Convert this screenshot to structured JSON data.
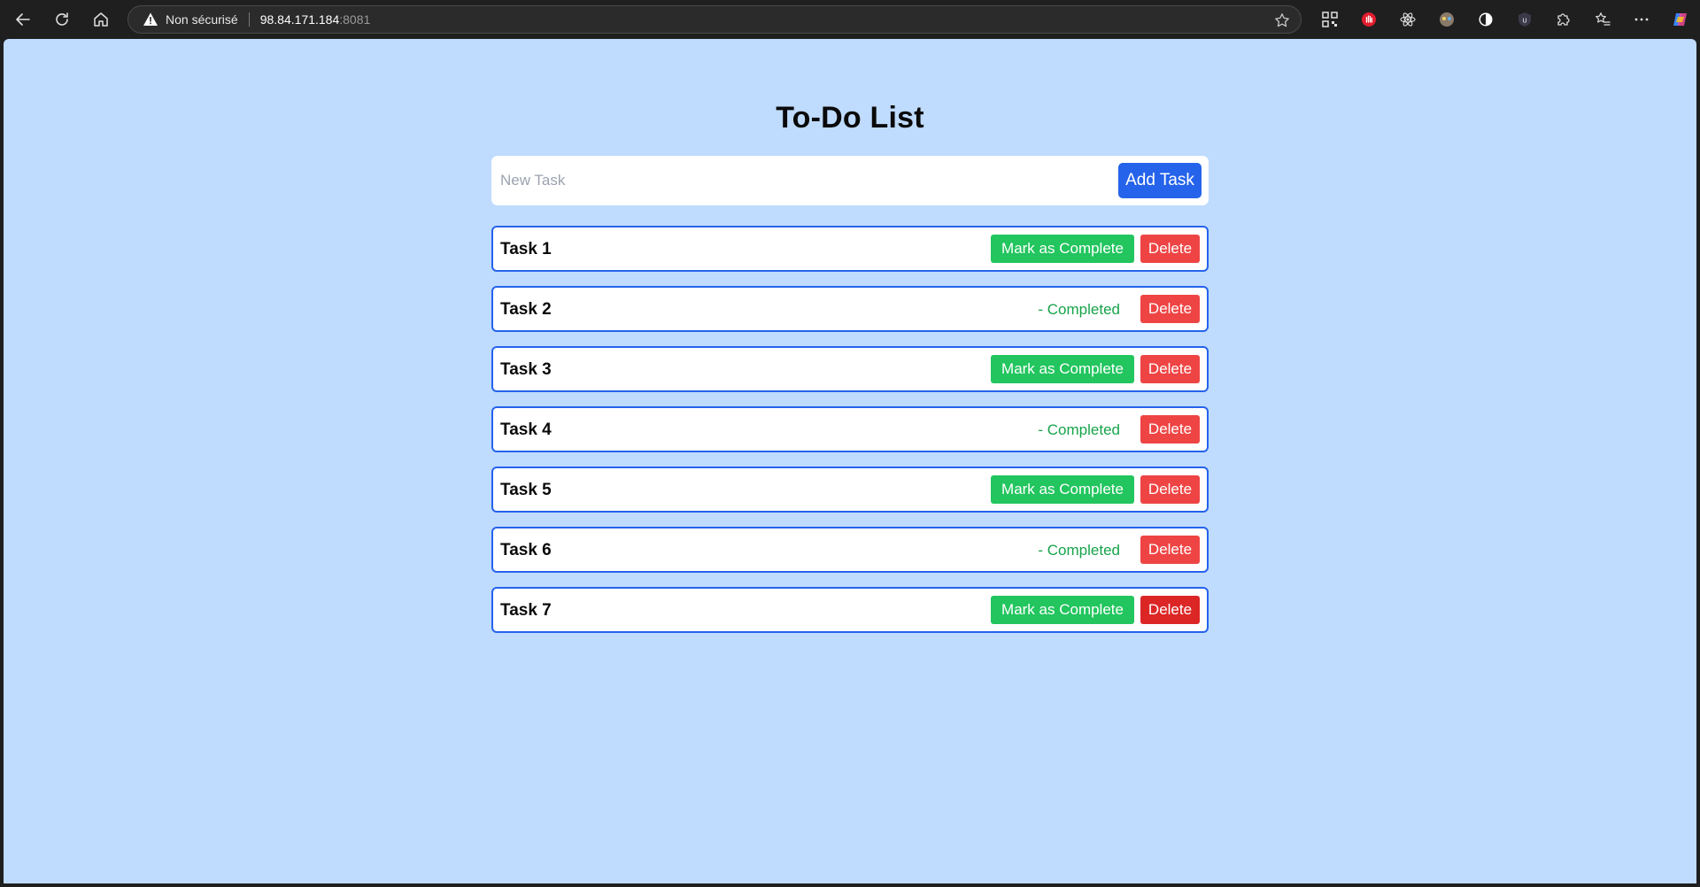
{
  "browser": {
    "security_text": "Non sécurisé",
    "url_host": "98.84.171.184",
    "url_port": ":8081"
  },
  "page": {
    "title": "To-Do List",
    "input_placeholder": "New Task",
    "input_value": "",
    "add_button_label": "Add Task"
  },
  "tasks": [
    {
      "name": "Task 1",
      "completed": false,
      "complete_label": "Mark as Complete",
      "status_text": "",
      "delete_label": "Delete"
    },
    {
      "name": "Task 2",
      "completed": true,
      "complete_label": "",
      "status_text": "- Completed",
      "delete_label": "Delete"
    },
    {
      "name": "Task 3",
      "completed": false,
      "complete_label": "Mark as Complete",
      "status_text": "",
      "delete_label": "Delete"
    },
    {
      "name": "Task 4",
      "completed": true,
      "complete_label": "",
      "status_text": "- Completed",
      "delete_label": "Delete"
    },
    {
      "name": "Task 5",
      "completed": false,
      "complete_label": "Mark as Complete",
      "status_text": "",
      "delete_label": "Delete"
    },
    {
      "name": "Task 6",
      "completed": true,
      "complete_label": "",
      "status_text": "- Completed",
      "delete_label": "Delete"
    },
    {
      "name": "Task 7",
      "completed": false,
      "complete_label": "Mark as Complete",
      "status_text": "",
      "delete_label": "Delete",
      "delete_hovered": true
    }
  ],
  "colors": {
    "page_background": "#bfdbfe",
    "accent_blue": "#2563eb",
    "complete_green": "#22c55e",
    "completed_text_green": "#16a34a",
    "delete_red": "#ef4444",
    "delete_red_hover": "#dc2626"
  },
  "icons": {
    "back": "back-arrow-icon",
    "refresh": "refresh-icon",
    "home": "home-icon",
    "security_warning": "warning-triangle-icon",
    "favorite": "star-icon",
    "toolbar": [
      "qr-code-icon",
      "hand-stop-icon",
      "react-icon",
      "game-controller-icon",
      "circle-half-icon",
      "ublock-icon",
      "puzzle-extensions-icon",
      "favorites-list-icon",
      "more-dots-icon",
      "copilot-icon"
    ]
  }
}
